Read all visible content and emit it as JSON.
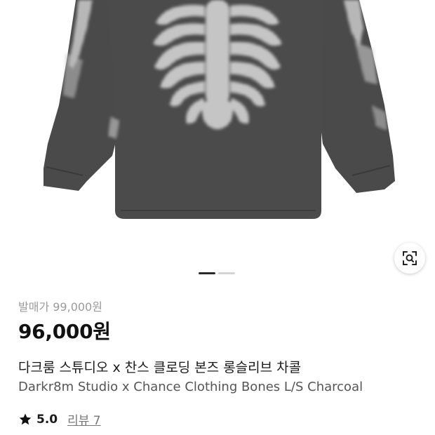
{
  "product": {
    "original_price": "발매가 99,000원",
    "sale_price": "96,000원",
    "name_ko": "다크룸 스튜디오 x 찬스 클로딩 본즈 롱슬리브 차콜",
    "name_en": "Darkr8m Studio x Chance Clothing Bones L/S Charcoal",
    "rating": "5.0",
    "reviews_label": "리뷰 7"
  },
  "gallery": {
    "image_count": 2,
    "current_index": 1
  },
  "icons": {
    "lens": "image-search-icon",
    "star": "star-icon"
  },
  "colors": {
    "shirt": "#4a4a4a",
    "indicator_active": "#2a2a2a",
    "indicator_inactive": "#d4d4d4"
  }
}
